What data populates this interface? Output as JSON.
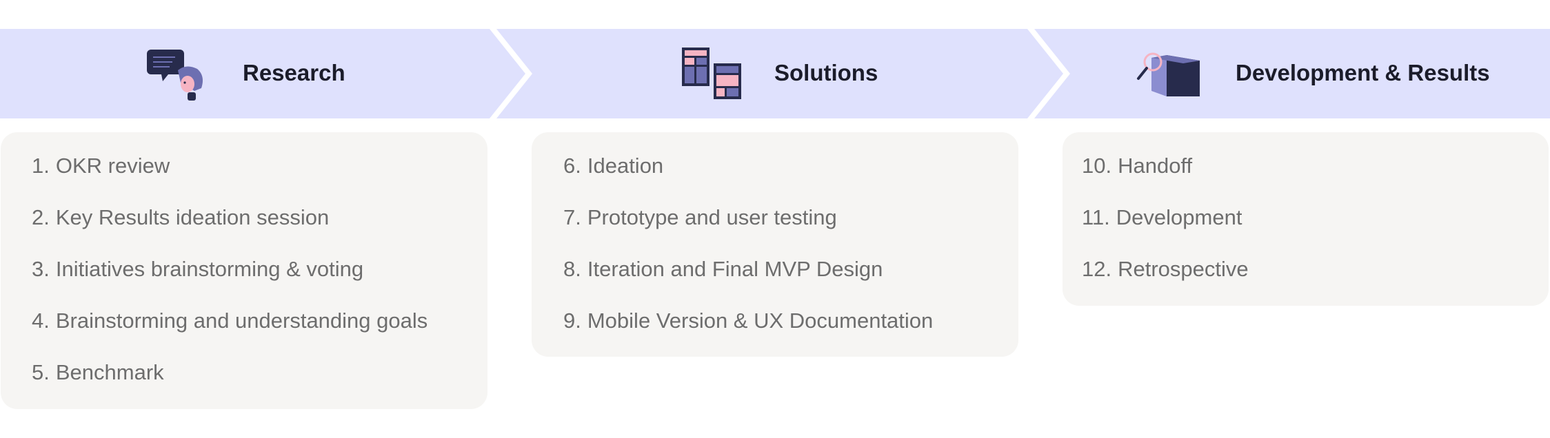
{
  "colors": {
    "banner": "#dfe1fd",
    "panel": "#f6f5f3",
    "title_text": "#1b1c2a",
    "step_text": "#6d6d6d",
    "icon_navy": "#272b4c",
    "icon_purple": "#6d6fb1",
    "icon_pink": "#f6b4c3"
  },
  "stages": [
    {
      "title": "Research",
      "icon": "chat-person-icon",
      "steps": [
        {
          "num": "1.",
          "text": "OKR review"
        },
        {
          "num": "2.",
          "text": "Key Results ideation session"
        },
        {
          "num": "3.",
          "text": "Initiatives brainstorming & voting"
        },
        {
          "num": "4.",
          "text": "Brainstorming and understanding goals"
        },
        {
          "num": "5.",
          "text": "Benchmark"
        }
      ]
    },
    {
      "title": "Solutions",
      "icon": "layout-screens-icon",
      "steps": [
        {
          "num": "6.",
          "text": "Ideation"
        },
        {
          "num": "7.",
          "text": "Prototype and user testing"
        },
        {
          "num": "8.",
          "text": "Iteration and Final MVP Design"
        },
        {
          "num": "9.",
          "text": "Mobile Version & UX Documentation"
        }
      ]
    },
    {
      "title": "Development & Results",
      "icon": "box-magnifier-icon",
      "steps": [
        {
          "num": "10.",
          "text": "Handoff"
        },
        {
          "num": "11.",
          "text": "Development"
        },
        {
          "num": "12.",
          "text": "Retrospective"
        }
      ]
    }
  ]
}
